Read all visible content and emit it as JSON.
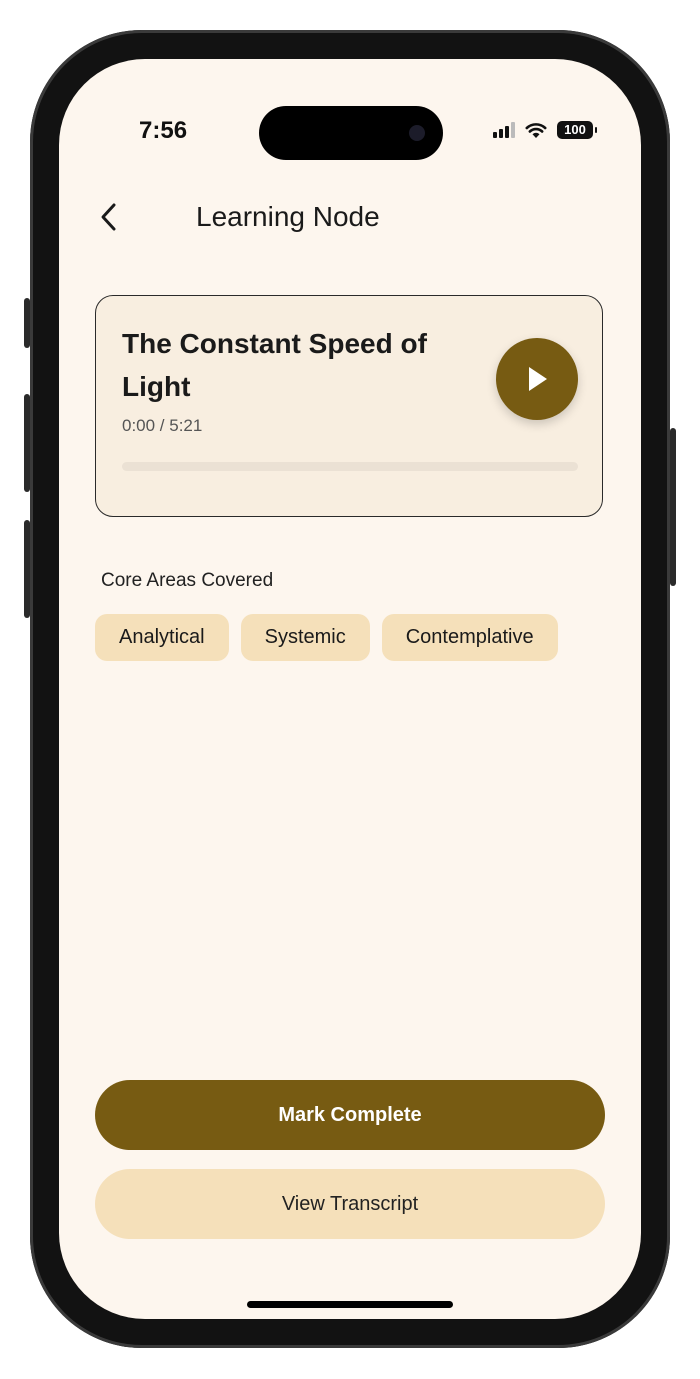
{
  "status_bar": {
    "time": "7:56",
    "battery": "100"
  },
  "header": {
    "title": "Learning Node",
    "back_icon": "chevron-left-icon"
  },
  "audio_card": {
    "title": "The Constant Speed of Light",
    "time": "0:00 / 5:21",
    "progress": 0,
    "play_icon": "play-icon"
  },
  "core_areas": {
    "label": "Core Areas Covered",
    "tags": [
      "Analytical",
      "Systemic",
      "Contemplative"
    ]
  },
  "actions": {
    "mark_complete": "Mark Complete",
    "view_transcript": "View Transcript"
  },
  "colors": {
    "background": "#fdf6ee",
    "accent": "#775b12",
    "tag_bg": "#f5e0ba",
    "card_bg": "#f8eee0"
  }
}
